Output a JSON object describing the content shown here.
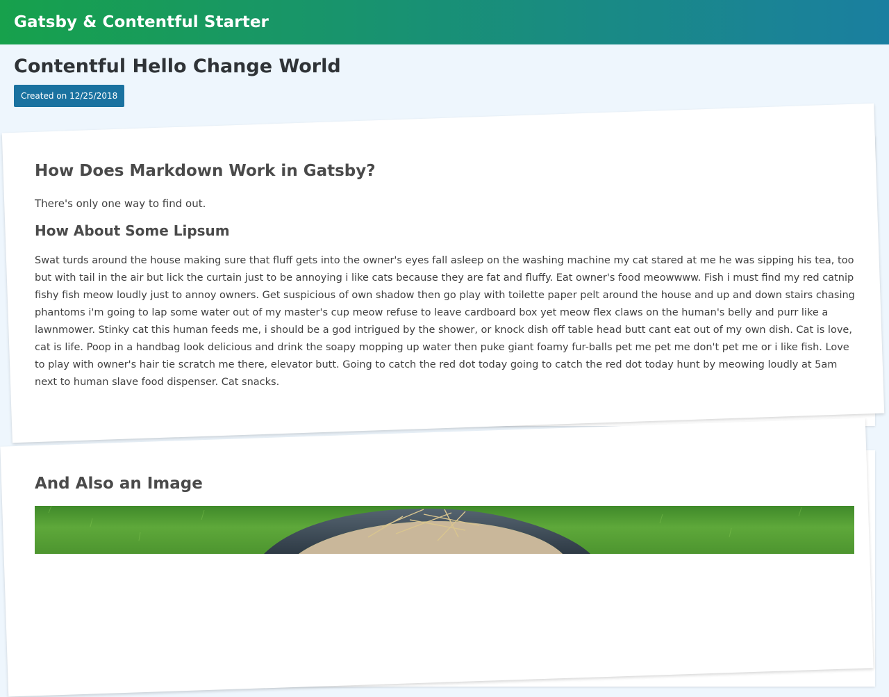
{
  "header": {
    "site_title": "Gatsby & Contentful Starter"
  },
  "post": {
    "title": "Contentful Hello Change World",
    "created_label": "Created on 12/25/2018"
  },
  "section1": {
    "heading": "How Does Markdown Work in Gatsby?",
    "intro": "There's only one way to find out.",
    "subheading": "How About Some Lipsum",
    "body": "Swat turds around the house making sure that fluff gets into the owner's eyes fall asleep on the washing machine my cat stared at me he was sipping his tea, too but with tail in the air but lick the curtain just to be annoying i like cats because they are fat and fluffy. Eat owner's food meowwww. Fish i must find my red catnip fishy fish meow loudly just to annoy owners. Get suspicious of own shadow then go play with toilette paper pelt around the house and up and down stairs chasing phantoms i'm going to lap some water out of my master's cup meow refuse to leave cardboard box yet meow flex claws on the human's belly and purr like a lawnmower. Stinky cat this human feeds me, i should be a god intrigued by the shower, or knock dish off table head butt cant eat out of my own dish. Cat is love, cat is life. Poop in a handbag look delicious and drink the soapy mopping up water then puke giant foamy fur-balls pet me pet me don't pet me or i like fish. Love to play with owner's hair tie scratch me there, elevator butt. Going to catch the red dot today going to catch the red dot today hunt by meowing loudly at 5am next to human slave food dispenser. Cat snacks."
  },
  "section2": {
    "heading": "And Also an Image"
  },
  "colors": {
    "header_gradient_start": "#17a14c",
    "header_gradient_end": "#1a7fa0",
    "badge_bg": "#1a72a0",
    "page_bg": "#eef6fd"
  }
}
